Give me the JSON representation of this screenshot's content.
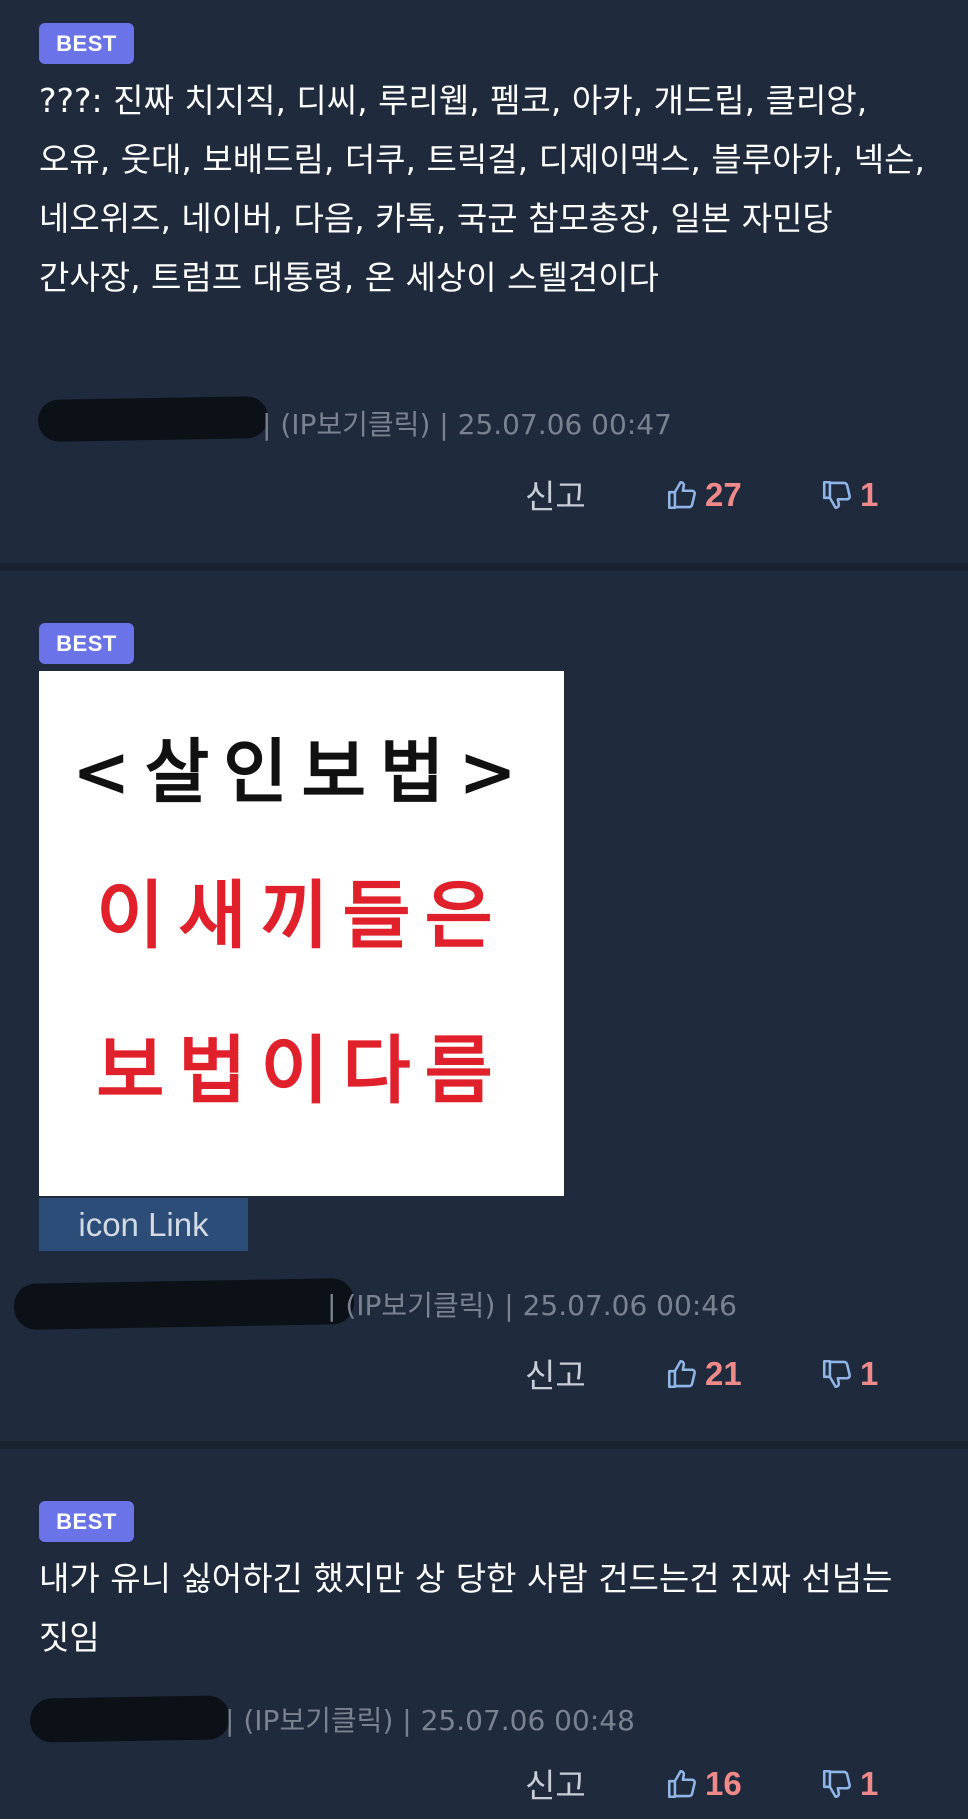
{
  "comments": [
    {
      "badge": "BEST",
      "text": "???: 진짜 치지직, 디씨, 루리웹, 펨코, 아카, 개드립, 클리앙, 오유, 웃대, 보배드림, 더쿠, 트릭걸, 디제이맥스, 블루아카, 넥슨, 네오위즈, 네이버, 다음, 카톡, 국군 참모총장, 일본 자민당 간사장, 트럼프 대통령, 온 세상이 스텔견이다",
      "meta": "| (IP보기클릭) | 25.07.06 00:47",
      "report": "신고",
      "likes": "27",
      "dislikes": "1"
    },
    {
      "badge": "BEST",
      "image": {
        "line1": "<살인보법>",
        "line2": "이새끼들은",
        "line3": "보법이다름"
      },
      "icon_link": "icon Link",
      "meta": "| (IP보기클릭) | 25.07.06 00:46",
      "report": "신고",
      "likes": "21",
      "dislikes": "1"
    },
    {
      "badge": "BEST",
      "text": "내가 유니 싫어하긴 했지만 상 당한 사람 건드는건 진짜 선넘는 짓임",
      "meta": "| (IP보기클릭) | 25.07.06 00:48",
      "report": "신고",
      "likes": "16",
      "dislikes": "1"
    }
  ],
  "colors": {
    "background": "#1f2a3c",
    "badge": "#6a73e8",
    "vote_count": "#f08a8a",
    "vote_icon": "#8fb6e6",
    "image_red": "#e0202a"
  }
}
